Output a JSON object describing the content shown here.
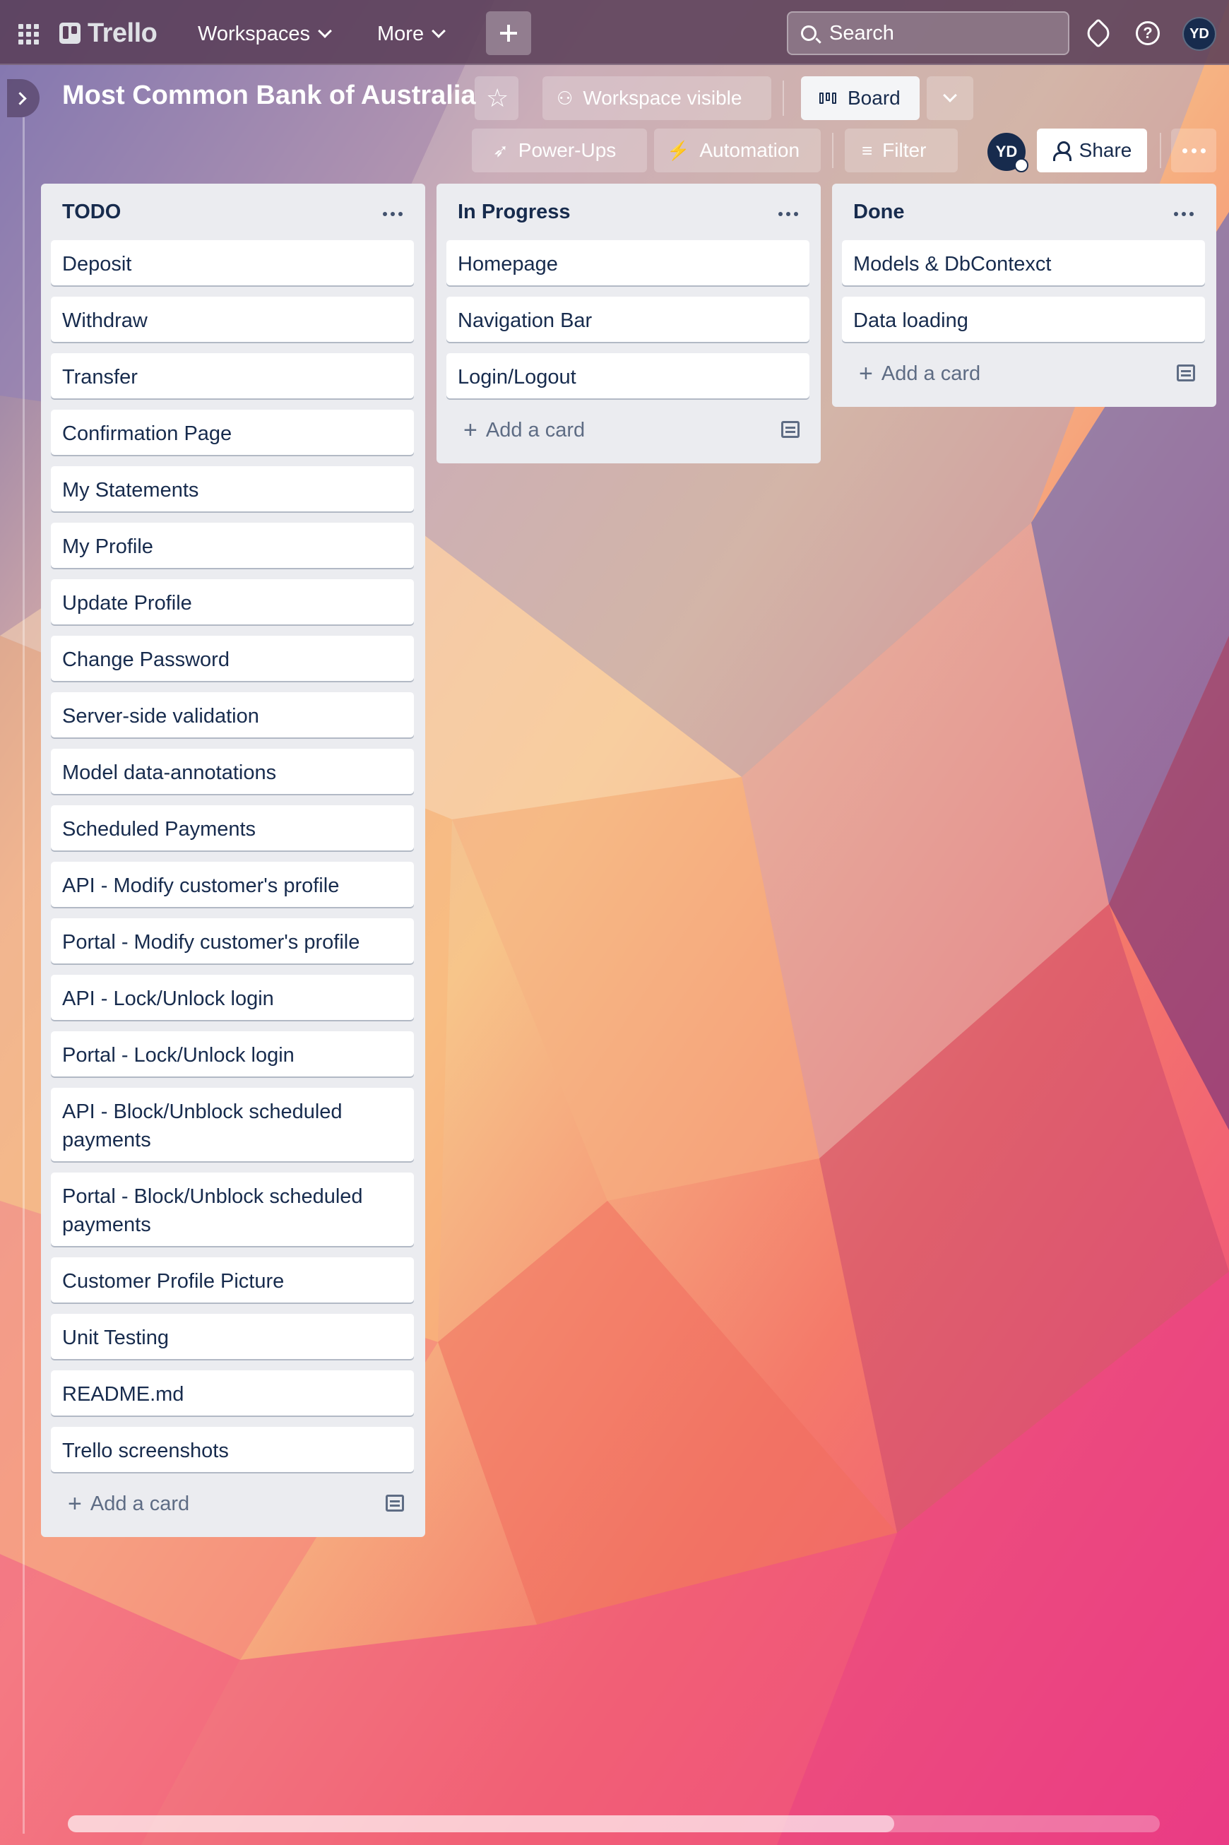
{
  "topbar": {
    "brand": "Trello",
    "workspaces_label": "Workspaces",
    "more_label": "More",
    "search_placeholder": "Search",
    "user_initials": "YD"
  },
  "board_header": {
    "title": "Most Common Bank of Australia",
    "visibility_label": "Workspace visible",
    "view_label": "Board",
    "powerups_label": "Power-Ups",
    "automation_label": "Automation",
    "filter_label": "Filter",
    "member_initials": "YD",
    "share_label": "Share"
  },
  "lists": [
    {
      "title": "TODO",
      "cards": [
        "Deposit",
        "Withdraw",
        "Transfer",
        "Confirmation Page",
        "My Statements",
        "My Profile",
        "Update Profile",
        "Change Password",
        "Server-side validation",
        "Model data-annotations",
        "Scheduled Payments",
        "API - Modify customer's profile",
        "Portal - Modify customer's profile",
        "API - Lock/Unlock login",
        "Portal - Lock/Unlock login",
        "API - Block/Unblock scheduled payments",
        "Portal - Block/Unblock scheduled payments",
        "Customer Profile Picture",
        "Unit Testing",
        "README.md",
        "Trello screenshots"
      ],
      "add_card_label": "Add a card"
    },
    {
      "title": "In Progress",
      "cards": [
        "Homepage",
        "Navigation Bar",
        "Login/Logout"
      ],
      "add_card_label": "Add a card"
    },
    {
      "title": "Done",
      "cards": [
        "Models & DbContexct",
        "Data loading"
      ],
      "add_card_label": "Add a card"
    }
  ],
  "icons": {
    "apps": "grid-icon",
    "create": "plus-icon",
    "search": "search-icon",
    "notifications": "bell-icon",
    "help": "help-icon",
    "star": "star-icon",
    "visibility": "people-icon",
    "view": "board-icon",
    "powerups": "rocket-icon",
    "automation": "bolt-icon",
    "filter": "filter-icon",
    "share": "add-person-icon",
    "menu": "more-icon",
    "template": "card-template-icon"
  },
  "colors": {
    "topbar": "#583c56",
    "list_bg": "#ebecf0",
    "card_bg": "#ffffff",
    "text": "#172b4d",
    "avatar": "#172b4d"
  }
}
